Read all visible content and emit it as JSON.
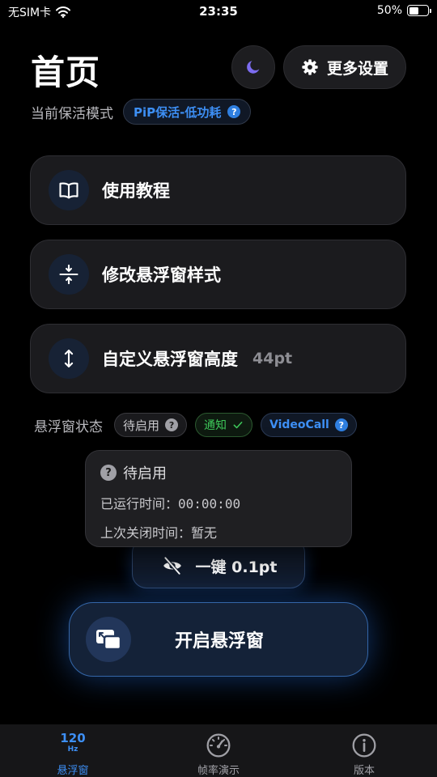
{
  "status_bar": {
    "carrier": "无SIM卡",
    "time": "23:35",
    "battery_text": "50%",
    "battery_level": 0.5
  },
  "header": {
    "title": "首页",
    "more_settings_label": "更多设置"
  },
  "keepalive": {
    "label": "当前保活模式",
    "mode": "PiP保活-低功耗"
  },
  "menu": {
    "tutorial": {
      "label": "使用教程"
    },
    "style": {
      "label": "修改悬浮窗样式"
    },
    "height": {
      "label": "自定义悬浮窗高度",
      "value": "44pt"
    }
  },
  "floating_state": {
    "label": "悬浮窗状态",
    "pending_chip": "待启用",
    "notify_chip": "通知",
    "videocall_chip": "VideoCall"
  },
  "popover": {
    "title": "待启用",
    "runtime_label": "已运行时间：",
    "runtime_value": "00:00:00",
    "last_close_label": "上次关闭时间：",
    "last_close_value": "暂无"
  },
  "hide_button": {
    "label": "一键 0.1pt"
  },
  "main_button": {
    "label": "开启悬浮窗"
  },
  "tabs": [
    {
      "label": "悬浮窗",
      "icon": "120hz-icon",
      "icon_text": "120",
      "icon_unit": "Hz",
      "active": true
    },
    {
      "label": "帧率演示",
      "icon": "speedometer-icon",
      "active": false
    },
    {
      "label": "版本",
      "icon": "info-icon",
      "active": false
    }
  ],
  "colors": {
    "accent": "#3d8ff5",
    "success": "#3ec95a",
    "moon": "#7c6cf0",
    "background": "#000000"
  }
}
